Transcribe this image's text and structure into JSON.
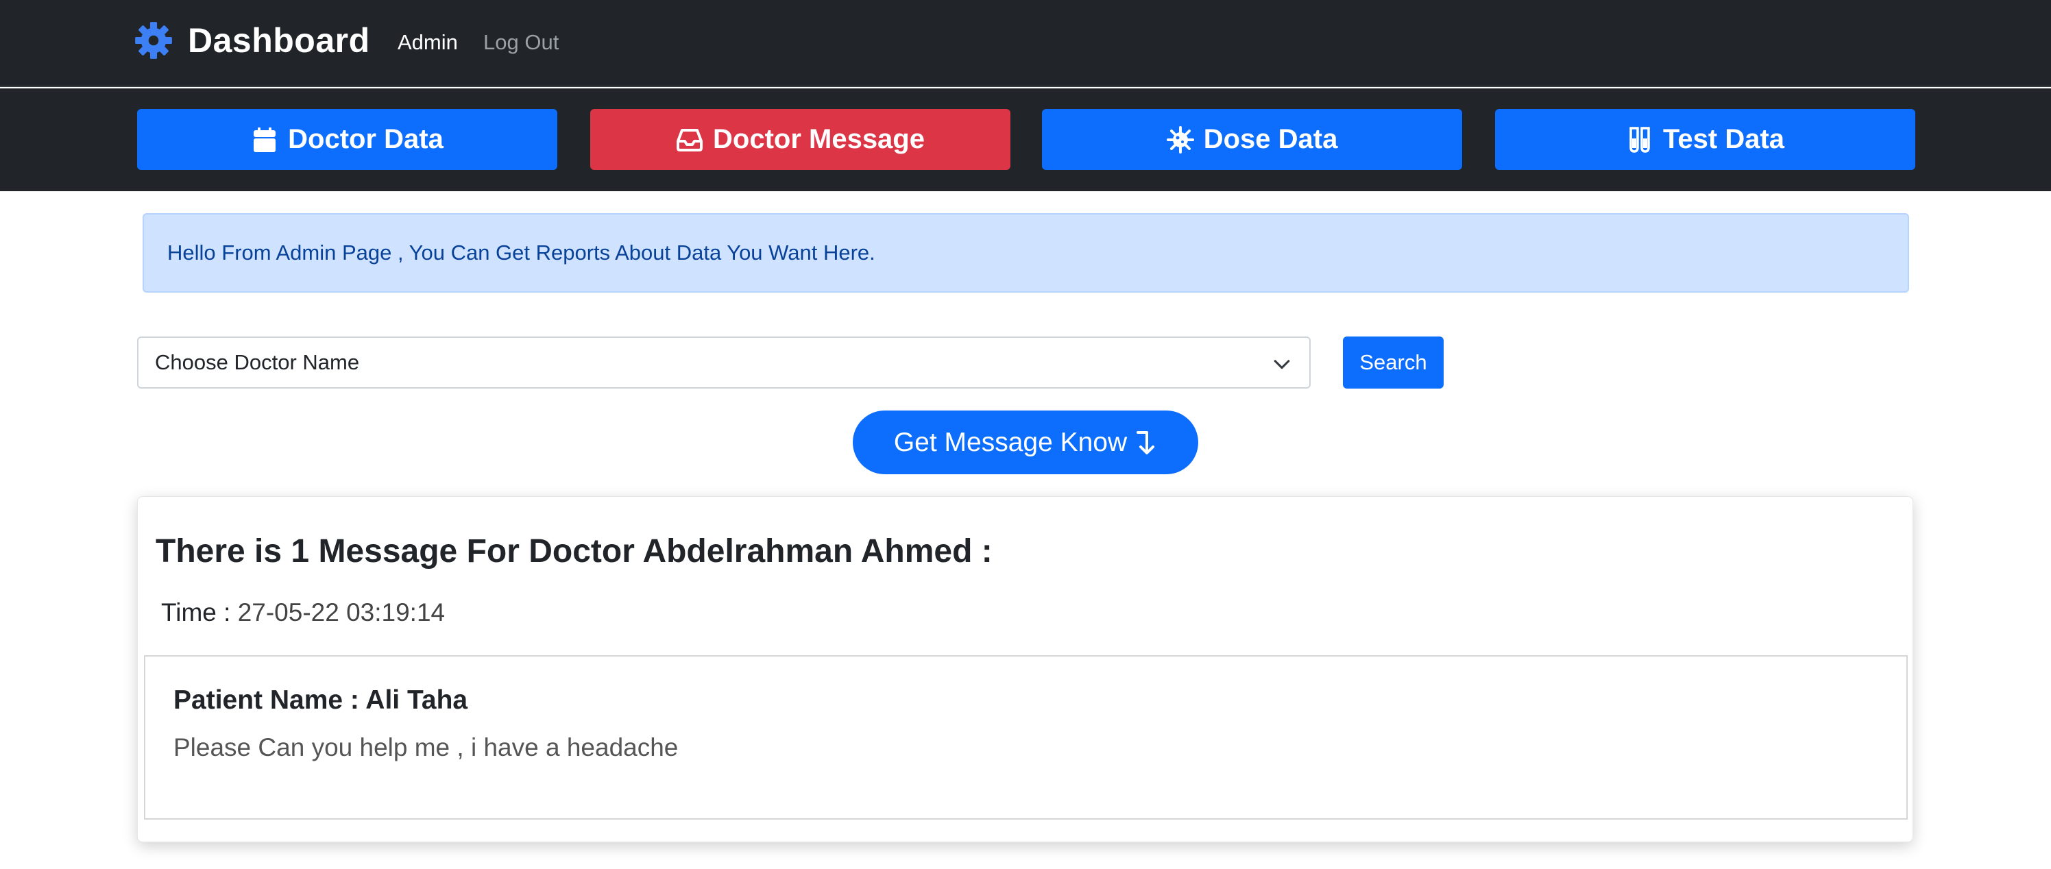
{
  "navbar": {
    "brand": "Dashboard",
    "brand_icon": "gear-icon",
    "links": {
      "admin": "Admin",
      "logout": "Log Out"
    }
  },
  "categories": [
    {
      "label": "Doctor Data",
      "icon": "calendar-icon",
      "color": "#0d6efd"
    },
    {
      "label": "Doctor Message",
      "icon": "inbox-icon",
      "color": "#dc3545"
    },
    {
      "label": "Dose Data",
      "icon": "virus-icon",
      "color": "#0d6efd"
    },
    {
      "label": "Test Data",
      "icon": "test-tubes-icon",
      "color": "#0d6efd"
    }
  ],
  "alert": {
    "text": "Hello From Admin Page , You Can Get Reports About Data You Want Here."
  },
  "filter": {
    "select_value": "Choose Doctor Name",
    "search_label": "Search"
  },
  "get_message": {
    "label": "Get Message Know",
    "icon": "arrow-down-icon"
  },
  "result": {
    "title": "There is 1 Message For Doctor Abdelrahman Ahmed :",
    "time_label": "Time :",
    "time_value": "27-05-22 03:19:14",
    "message": {
      "patient": "Patient Name : Ali Taha",
      "text": "Please Can you help me , i have a headache"
    }
  },
  "colors": {
    "navbar_bg": "#212529",
    "primary": "#0d6efd",
    "danger": "#dc3545",
    "alert_bg": "#cfe2ff",
    "alert_text": "#084298"
  }
}
